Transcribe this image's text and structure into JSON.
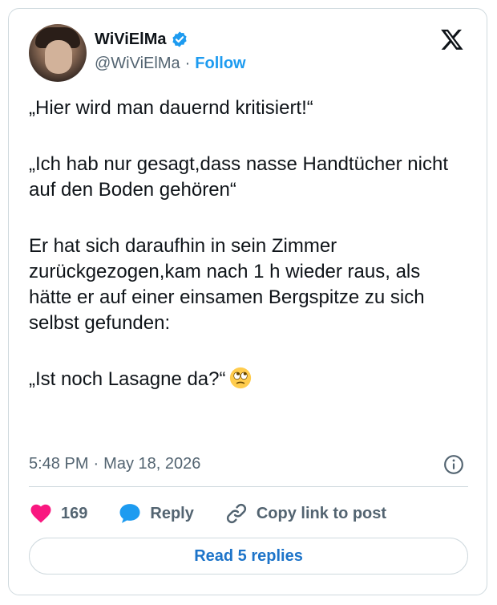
{
  "author": {
    "display_name": "WiViElMa",
    "handle": "@WiViElMa",
    "separator": "·",
    "follow_label": "Follow",
    "verified": true,
    "brand_color": "#1d9bf0"
  },
  "tweet": {
    "paragraphs": [
      "„Hier wird man dauernd kritisiert!“",
      "„Ich hab nur gesagt,dass nasse Handtücher nicht auf den Boden gehören“",
      "Er hat sich daraufhin in sein Zimmer zurückgezogen,kam nach 1 h wieder raus, als hätte er auf einer einsamen Bergspitze zu sich selbst gefunden:",
      "„Ist noch Lasagne da?“"
    ],
    "emoji": "face-with-rolling-eyes",
    "time": "5:48 PM",
    "date": "May 18, 2026"
  },
  "actions": {
    "like_count": "169",
    "reply_label": "Reply",
    "copy_label": "Copy link to post",
    "like_color": "#f91880",
    "reply_color": "#1d9bf0"
  },
  "footer": {
    "read_replies_label": "Read 5 replies"
  },
  "icons": [
    "verified-badge-icon",
    "x-logo-icon",
    "info-icon",
    "heart-icon",
    "speech-bubble-icon",
    "link-icon"
  ]
}
